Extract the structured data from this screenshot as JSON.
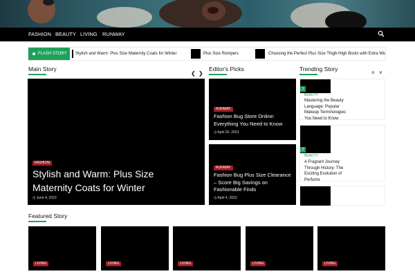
{
  "nav": {
    "items": [
      "FASHION",
      "BEAUTY",
      "LIVING",
      "RUNWAY"
    ],
    "search_icon": "search-icon"
  },
  "flash": {
    "label": "FLASH STORY",
    "items": [
      "Stylish and Warm: Plus Size Maternity Coats for Winter",
      "Plus Size Rompers",
      "Choosing the Perfect Plus Size Thigh-High Boots with Extra Wide Calf"
    ]
  },
  "main_story": {
    "heading": "Main Story",
    "category": "FASHION",
    "title": "Stylish and Warm: Plus Size Maternity Coats for Winter",
    "date": "June 4, 2023"
  },
  "editors_picks": {
    "heading": "Editor's Picks",
    "items": [
      {
        "category": "RUNWAY",
        "title": "Fashion Bug Store Online: Everything You Need to Know",
        "date": "April 20, 2023"
      },
      {
        "category": "RUNWAY",
        "title": "Fashion Bug Plus Size Clearance – Score Big Savings on Fashionable Finds",
        "date": "April 4, 2023"
      }
    ]
  },
  "trending": {
    "heading": "Trending Story",
    "items": [
      {
        "number": "1",
        "category": "BEAUTY",
        "title": "Mastering the Beauty Language: Popular Makeup Terminologies You Need to Know"
      },
      {
        "number": "2",
        "category": "BEAUTY",
        "title": "A Fragrant Journey Through History: The Exciting Evolution of Perfume"
      }
    ]
  },
  "featured": {
    "heading": "Featured Story",
    "items": [
      {
        "category": "LIVING"
      },
      {
        "category": "LIVING"
      },
      {
        "category": "LIVING"
      },
      {
        "category": "LIVING"
      },
      {
        "category": "LIVING"
      }
    ]
  },
  "colors": {
    "accent": "#21a05b",
    "category": "#a01e28",
    "nav_bg": "#000000"
  }
}
